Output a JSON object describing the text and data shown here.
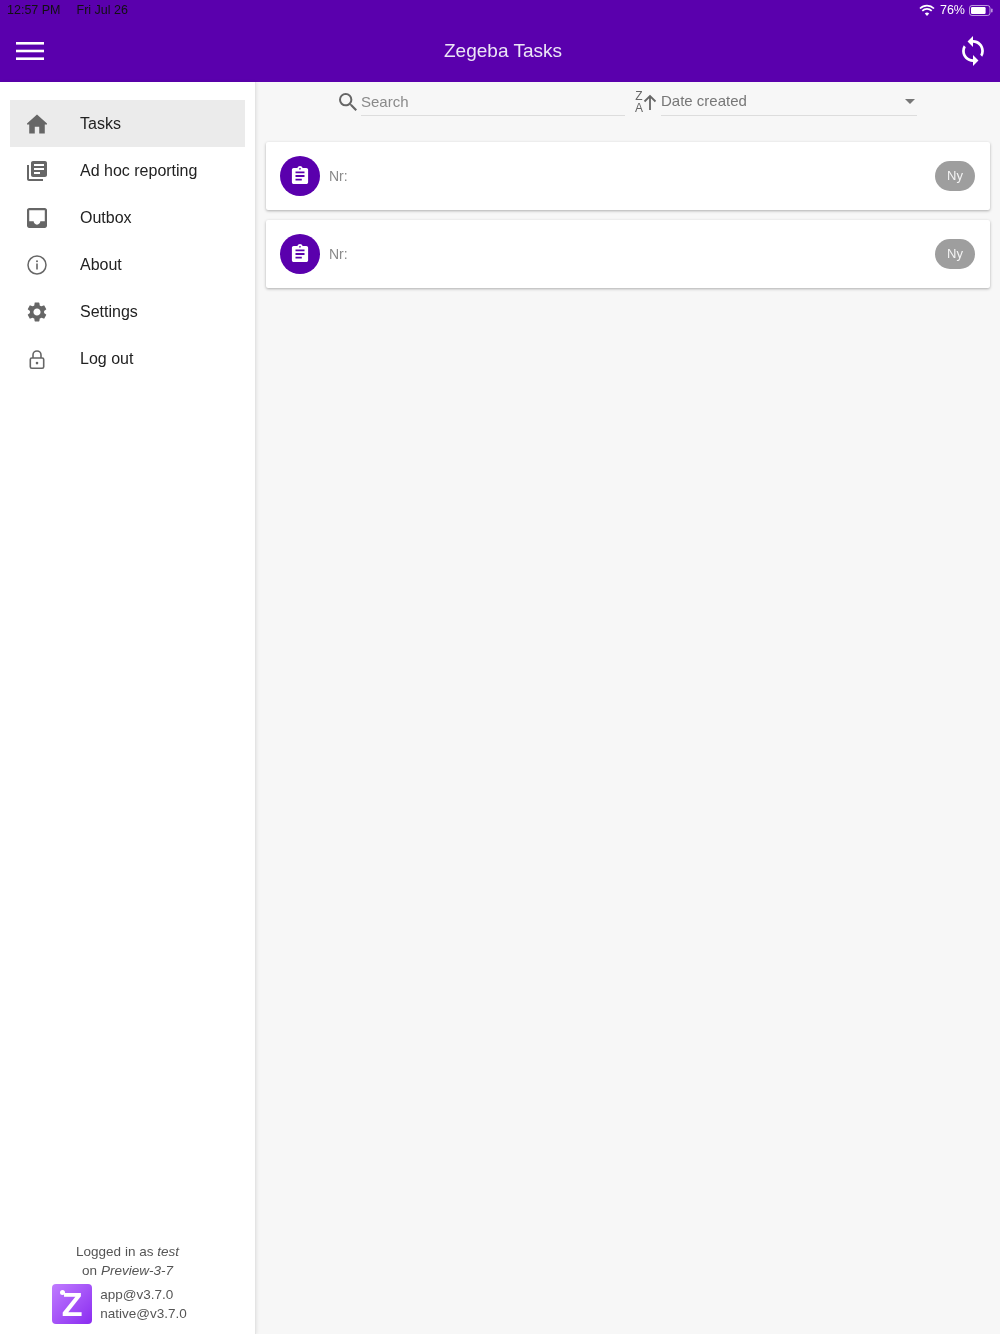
{
  "status_bar": {
    "time": "12:57 PM",
    "date": "Fri Jul 26",
    "battery": "76%"
  },
  "header": {
    "title": "Zegeba Tasks"
  },
  "sidebar": {
    "items": [
      {
        "label": "Tasks",
        "kind": "home",
        "selected": true
      },
      {
        "label": "Ad hoc reporting",
        "kind": "reports",
        "selected": false
      },
      {
        "label": "Outbox",
        "kind": "outbox",
        "selected": false
      },
      {
        "label": "About",
        "kind": "info",
        "selected": false
      },
      {
        "label": "Settings",
        "kind": "settings",
        "selected": false
      },
      {
        "label": "Log out",
        "kind": "lock",
        "selected": false
      }
    ],
    "footer": {
      "logged_in": "Logged in as *test*",
      "server": "on *Preview-3-7*",
      "logo": "Z",
      "versions": [
        "app@v3.7.0",
        "native@v3.7.0"
      ]
    }
  },
  "toolbar": {
    "search": {
      "placeholder": "Search"
    },
    "sort": {
      "direction_letters": [
        "Z",
        "A"
      ],
      "value": "Date created"
    }
  },
  "tasks": [
    {
      "label": "Nr:",
      "badge": "Ny"
    },
    {
      "label": "Nr:",
      "badge": "Ny"
    }
  ]
}
